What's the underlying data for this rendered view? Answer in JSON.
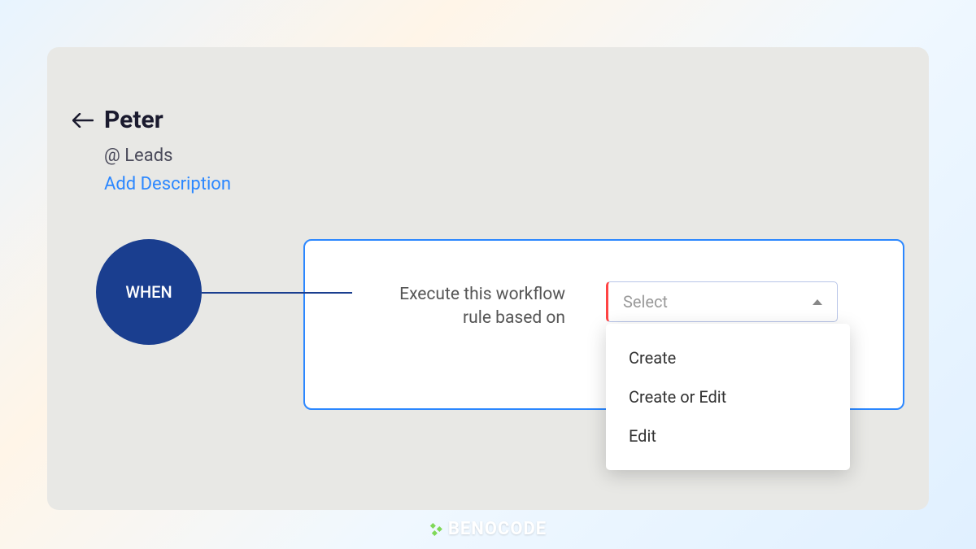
{
  "header": {
    "title": "Peter",
    "module": "@ Leads",
    "add_description": "Add Description"
  },
  "workflow": {
    "when_label": "WHEN",
    "rule_label": "Execute this workflow rule based on",
    "select": {
      "placeholder": "Select",
      "options": [
        "Create",
        "Create or Edit",
        "Edit"
      ]
    }
  },
  "brand": {
    "name": "BENOCODE"
  }
}
